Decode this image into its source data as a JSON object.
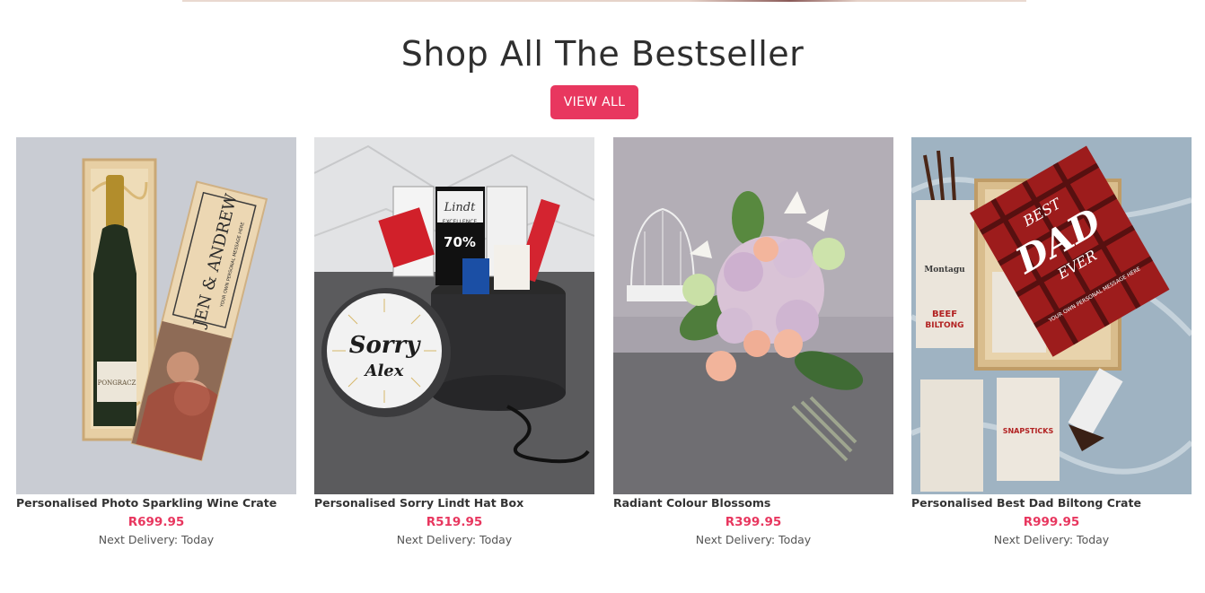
{
  "section": {
    "title": "Shop All The Bestseller",
    "view_all_label": "VIEW ALL"
  },
  "accent_color": "#e8375f",
  "products": [
    {
      "name": "Personalised Photo Sparkling Wine Crate",
      "price": "R699.95",
      "delivery": "Next Delivery: Today",
      "image_text": [
        "JEN & ANDREW",
        "YOUR OWN PERSONAL MESSAGE HERE",
        "PONGRACZ"
      ]
    },
    {
      "name": "Personalised Sorry Lindt Hat Box",
      "price": "R519.95",
      "delivery": "Next Delivery: Today",
      "image_text": [
        "Sorry",
        "Alex",
        "Lindt",
        "EXCELLENCE",
        "70%"
      ]
    },
    {
      "name": "Radiant Colour Blossoms",
      "price": "R399.95",
      "delivery": "Next Delivery: Today",
      "image_text": []
    },
    {
      "name": "Personalised Best Dad Biltong Crate",
      "price": "R999.95",
      "delivery": "Next Delivery: Today",
      "image_text": [
        "BEST",
        "DAD",
        "EVER",
        "YOUR OWN PERSONAL MESSAGE HERE",
        "Montagu",
        "BEEF",
        "BILTONG",
        "SNAPSTICKS"
      ]
    }
  ]
}
